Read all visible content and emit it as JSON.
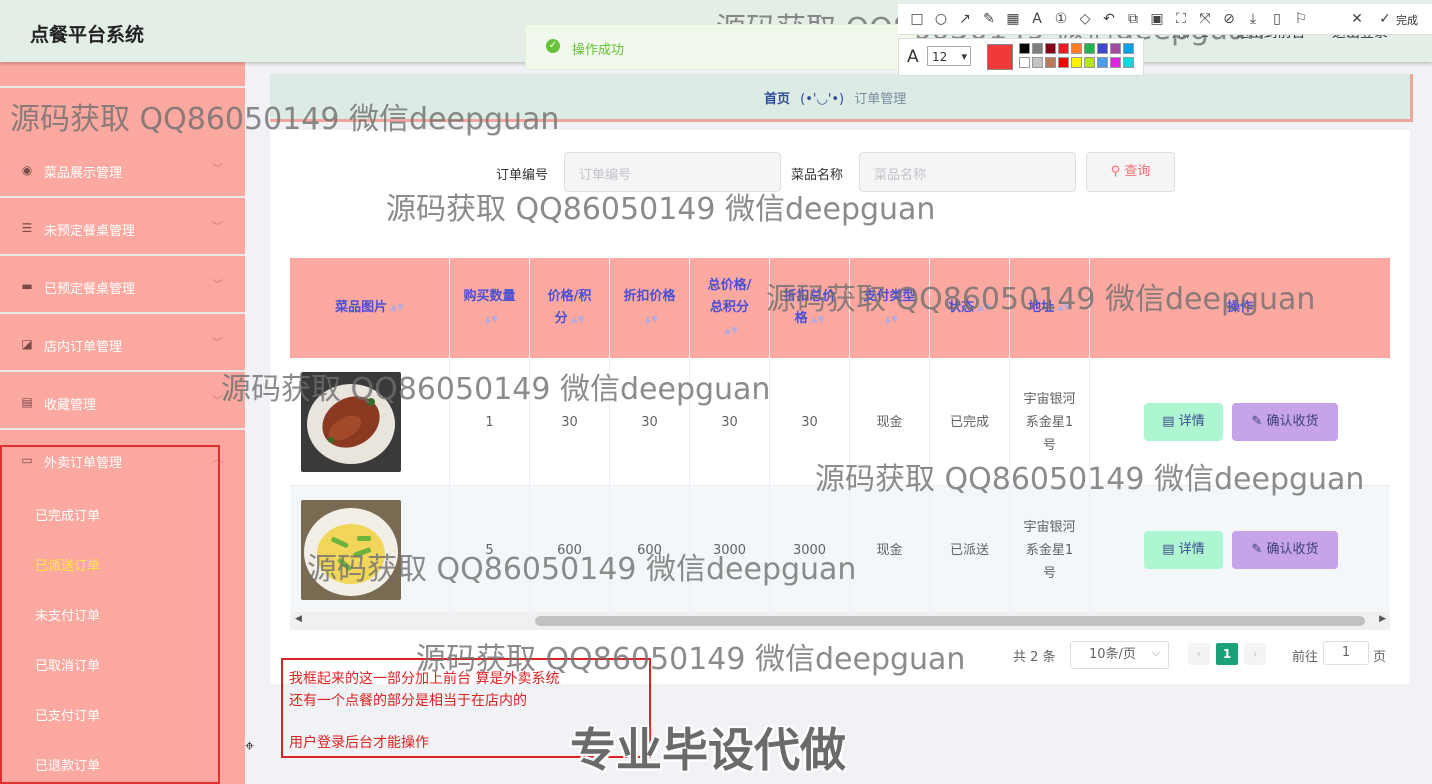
{
  "app": {
    "title": "点餐平台系统"
  },
  "header": {
    "link_front": "退出到前台",
    "link_logout": "退出登录",
    "link_user": "用户1"
  },
  "toast": {
    "message": "操作成功"
  },
  "annotation_tool": {
    "done_label": "完成",
    "font_size": "12",
    "current_color": "#f03a3a",
    "palette": [
      "#000000",
      "#7f7f7f",
      "#880015",
      "#ed1c24",
      "#ff7f27",
      "#22b14c",
      "#3f48cc",
      "#a349a4",
      "#00a2e8",
      "#ffffff",
      "#c3c3c3",
      "#b97a57",
      "#ff0000",
      "#fff200",
      "#b5e61d",
      "#4a9eed",
      "#e024e0",
      "#13d7e0"
    ]
  },
  "sidebar": {
    "items": [
      {
        "label": "菜品展示管理",
        "icon": "bulb-icon"
      },
      {
        "label": "未预定餐桌管理",
        "icon": "list-icon"
      },
      {
        "label": "已预定餐桌管理",
        "icon": "monitor-icon"
      },
      {
        "label": "店内订单管理",
        "icon": "chart-icon"
      },
      {
        "label": "收藏管理",
        "icon": "clipboard-icon"
      },
      {
        "label": "外卖订单管理",
        "icon": "tray-icon"
      }
    ],
    "subitems": [
      {
        "label": "已完成订单",
        "active": false
      },
      {
        "label": "已派送订单",
        "active": true
      },
      {
        "label": "未支付订单",
        "active": false
      },
      {
        "label": "已取消订单",
        "active": false
      },
      {
        "label": "已支付订单",
        "active": false
      },
      {
        "label": "已退款订单",
        "active": false
      }
    ]
  },
  "breadcrumb": {
    "home": "首页",
    "face": "(•'◡'•)",
    "current": "订单管理"
  },
  "search": {
    "order_no_label": "订单编号",
    "order_no_placeholder": "订单编号",
    "dish_name_label": "菜品名称",
    "dish_name_placeholder": "菜品名称",
    "query_button": "查询"
  },
  "table": {
    "columns": [
      "菜品图片",
      "购买数量",
      "价格/积分",
      "折扣价格",
      "总价格/总积分",
      "折扣总价格",
      "支付类型",
      "状态",
      "地址",
      "操作"
    ],
    "rows": [
      {
        "qty": "1",
        "price": "30",
        "discount": "30",
        "total": "30",
        "discount_total": "30",
        "pay_type": "现金",
        "status": "已完成",
        "address": "宇宙银河系金星1号"
      },
      {
        "qty": "5",
        "price": "600",
        "discount": "600",
        "total": "3000",
        "discount_total": "3000",
        "pay_type": "现金",
        "status": "已派送",
        "address": "宇宙银河系金星1号"
      }
    ],
    "detail_button": "详情",
    "confirm_button": "确认收货"
  },
  "pagination": {
    "total_text": "共 2 条",
    "page_size": "10条/页",
    "current_page": "1",
    "goto_label": "前往",
    "goto_value": "1",
    "page_unit": "页"
  },
  "annotation_note": {
    "line1": "我框起来的这一部分加上前台 算是外卖系统",
    "line2": "还有一个点餐的部分是相当于在店内的",
    "line3": "用户登录后台才能操作"
  },
  "watermark": {
    "text": "源码获取 QQ86050149 微信deepguan"
  },
  "banner": {
    "text": "专业毕设代做"
  }
}
